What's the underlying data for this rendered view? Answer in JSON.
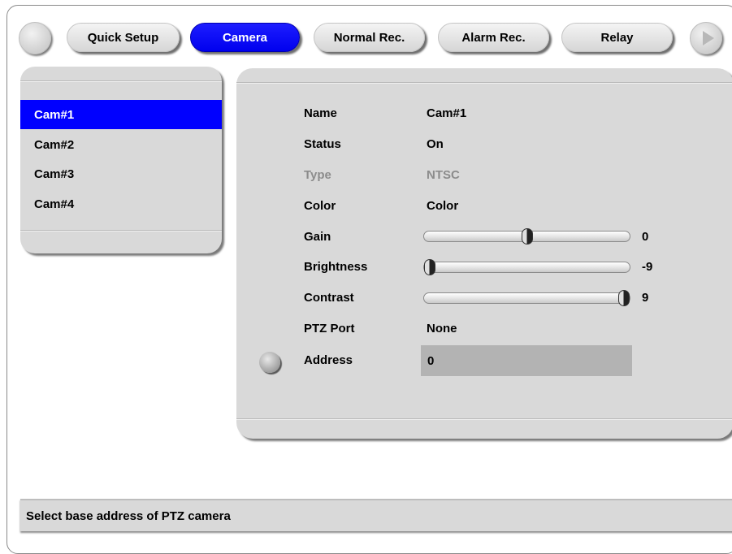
{
  "tabs": [
    {
      "label": "Quick Setup",
      "active": false
    },
    {
      "label": "Camera",
      "active": true
    },
    {
      "label": "Normal Rec.",
      "active": false
    },
    {
      "label": "Alarm Rec.",
      "active": false
    },
    {
      "label": "Relay",
      "active": false
    }
  ],
  "cameras": [
    "Cam#1",
    "Cam#2",
    "Cam#3",
    "Cam#4"
  ],
  "selected_camera": "Cam#1",
  "settings": {
    "name": {
      "label": "Name",
      "value": "Cam#1"
    },
    "status": {
      "label": "Status",
      "value": "On"
    },
    "type": {
      "label": "Type",
      "value": "NTSC",
      "disabled": true
    },
    "color": {
      "label": "Color",
      "value": "Color"
    },
    "gain": {
      "label": "Gain",
      "value": "0",
      "min": -9,
      "max": 9
    },
    "brightness": {
      "label": "Brightness",
      "value": "-9",
      "min": -9,
      "max": 9
    },
    "contrast": {
      "label": "Contrast",
      "value": "9",
      "min": -9,
      "max": 9
    },
    "ptz_port": {
      "label": "PTZ Port",
      "value": "None"
    },
    "address": {
      "label": "Address",
      "value": "0"
    }
  },
  "status_message": "Select base address of PTZ camera",
  "colors": {
    "accent": "#0000ff",
    "panel": "#d9d9d9",
    "field": "#b3b3b3",
    "disabled_text": "#8c8c8c"
  },
  "icons": {
    "nav_left": "circle-button-icon",
    "nav_right": "play-arrow-icon",
    "row_marker": "circle-bullet-icon"
  }
}
